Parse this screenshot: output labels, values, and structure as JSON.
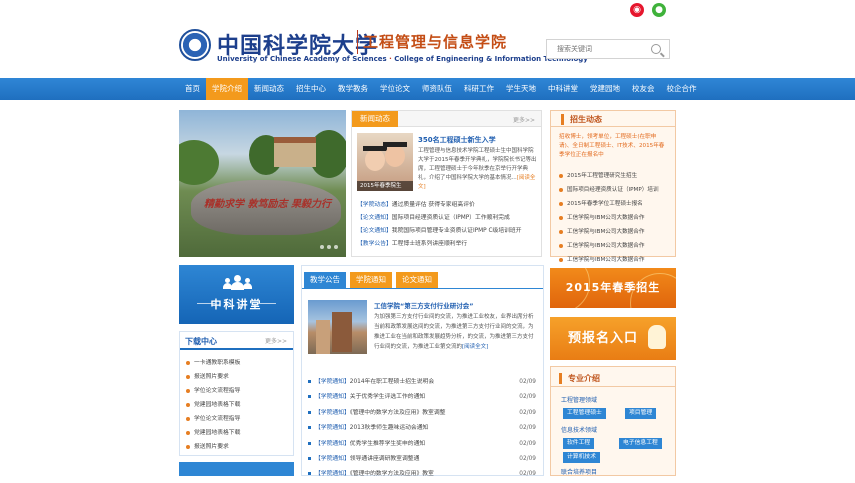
{
  "social": {
    "weibo_icon": "weibo-icon",
    "wechat_icon": "wechat-icon"
  },
  "header": {
    "logo_cn": "中国科学院大学",
    "logo_en_main": "University of Chinese Academy of Sciences",
    "logo_en_sep": " · ",
    "logo_en_college": "College of Engineering & Information Technology",
    "college_name": "工程管理与信息学院"
  },
  "search": {
    "placeholder": "搜索关键词"
  },
  "nav": {
    "items": [
      "首页",
      "学院介绍",
      "新闻动态",
      "招生中心",
      "教学教务",
      "学位论文",
      "师资队伍",
      "科研工作",
      "学生天地",
      "中科讲堂",
      "党建园地",
      "校友会",
      "校企合作"
    ],
    "active_index": 1
  },
  "slider": {
    "rock_text": "精勤求学 敦笃励志 果毅力行"
  },
  "news": {
    "tab": "新闻动态",
    "more": "更多>>",
    "featured_title": "350名工程硕士新生入学",
    "featured_caption": "2015年春季院生",
    "featured_body": "工程管理与信息技术学院工程硕士生中国科学院大学于2015年春季开学典礼，学院院长书记等出席，工程管理硕士于今年秋季在京举行开学典礼，介绍了中国科学院大学的基本情况...",
    "featured_read_more": "[阅读全文]",
    "items": [
      {
        "tag": "【学院动态】",
        "text": "通过质量评估 获得专家组高评价"
      },
      {
        "tag": "【论文通知】",
        "text": "国际项目经理资质认证（IPMP）工作顺利完成"
      },
      {
        "tag": "【论文通知】",
        "text": "我院国际项目管理专业资质认证IPMP C级培训班开"
      },
      {
        "tag": "【教学公告】",
        "text": "工程博士班系列讲座顺利举行"
      }
    ]
  },
  "admissions": {
    "title": "招生动态",
    "intro": "招收博士，领考单位，工程硕士(在职申请)、全日制工程硕士、IT技术、2015年春季学位正在报名中",
    "items": [
      "2015年工程管理研究生招生",
      "国际项目经理资质认证（IPMP）培训",
      "2015年春季学位工程硕士报名",
      "工信学院与IBM公司大数据合作",
      "工信学院与IBM公司大数据合作",
      "工信学院与IBM公司大数据合作",
      "工信学院与IBM公司大数据合作"
    ]
  },
  "lecture": {
    "title": "中科讲堂"
  },
  "downloads": {
    "title": "下载中心",
    "more": "更多>>",
    "items": [
      "一卡通教职系模板",
      "报送照片要求",
      "学位论文流程指导",
      "党建园地表格下载",
      "学位论文流程指导",
      "党建园地表格下载",
      "报送照片要求"
    ]
  },
  "notice": {
    "tabs": [
      "教学公告",
      "学院通知",
      "论文通知"
    ],
    "featured_title": "工信学院“第三方支付行业研讨会”",
    "featured_body": "为加强第三方支付行业间的交流，为推进工业校友，业界出席分析当前和政策发展这间的交流，为推进第三方支付行业间的交流，为推进工业在当前和政策发展趋势分析，的交流，为推进第三方支付行业间的交流，为推进工业第交流的",
    "featured_read_more": "[阅读全文]",
    "items": [
      {
        "tag": "【学院通知】",
        "text": "2014年在职工程硕士招生说明会",
        "date": "02/09"
      },
      {
        "tag": "【学院通知】",
        "text": "关于优秀学生评选工作的通知",
        "date": "02/09"
      },
      {
        "tag": "【学院通知】",
        "text": "《管理中的数学方法及应用》教室调整",
        "date": "02/09"
      },
      {
        "tag": "【学院通知】",
        "text": "2013秋季师生趣味运动会通知",
        "date": "02/09"
      },
      {
        "tag": "【学院通知】",
        "text": "优秀学生推荐学生奖申的通知",
        "date": "02/09"
      },
      {
        "tag": "【学院通知】",
        "text": "领导通讲座调研教室调整通",
        "date": "02/09"
      },
      {
        "tag": "【学院通知】",
        "text": "《管理中的数学方法及应用》教室",
        "date": "02/09"
      }
    ]
  },
  "banners": {
    "spring": "2015年春季招生",
    "signup": "预报名入口"
  },
  "majors": {
    "title": "专业介绍",
    "sections": [
      {
        "name": "工程管理领域",
        "chips": [
          "工程管理硕士",
          "项目管理"
        ]
      },
      {
        "name": "信息技术领域",
        "chips": [
          "软件工程",
          "电子信息工程",
          "计算机技术"
        ]
      },
      {
        "name": "联合培养项目"
      }
    ]
  }
}
